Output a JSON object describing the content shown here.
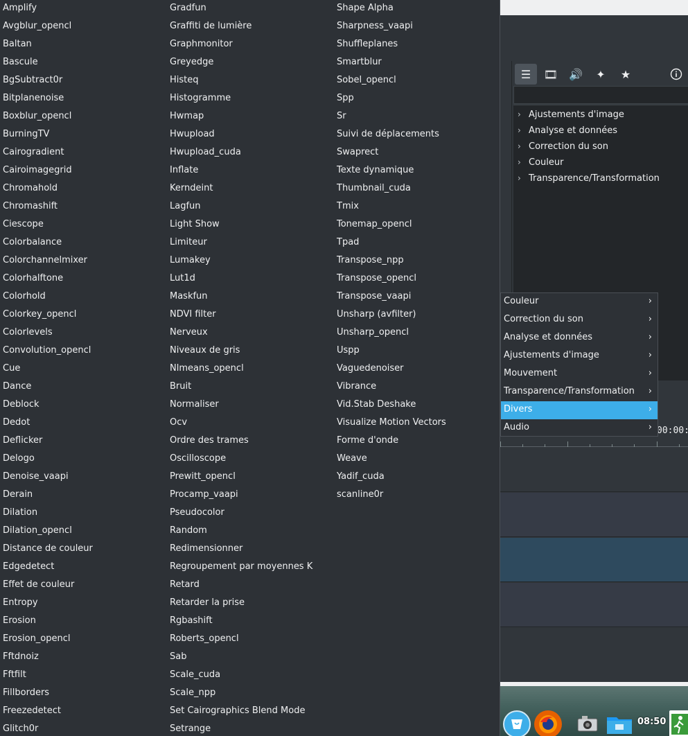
{
  "effects_menu": {
    "column_a": [
      "Amplify",
      "Avgblur_opencl",
      "Baltan",
      "Bascule",
      "BgSubtract0r",
      "Bitplanenoise",
      "Boxblur_opencl",
      "BurningTV",
      "Cairogradient",
      "Cairoimagegrid",
      "Chromahold",
      "Chromashift",
      "Ciescope",
      "Colorbalance",
      "Colorchannelmixer",
      "Colorhalftone",
      "Colorhold",
      "Colorkey_opencl",
      "Colorlevels",
      "Convolution_opencl",
      "Cue",
      "Dance",
      "Deblock",
      "Dedot",
      "Deflicker",
      "Delogo",
      "Denoise_vaapi",
      "Derain",
      "Dilation",
      "Dilation_opencl",
      "Distance de couleur",
      "Edgedetect",
      "Effet de couleur",
      "Entropy",
      "Erosion",
      "Erosion_opencl",
      "Fftdnoiz",
      "Fftfilt",
      "Fillborders",
      "Freezedetect",
      "Glitch0r"
    ],
    "column_b": [
      "Gradfun",
      "Graffiti de lumière",
      "Graphmonitor",
      "Greyedge",
      "Histeq",
      "Histogramme",
      "Hwmap",
      "Hwupload",
      "Hwupload_cuda",
      "Inflate",
      "Kerndeint",
      "Lagfun",
      "Light Show",
      "Limiteur",
      "Lumakey",
      "Lut1d",
      "Maskfun",
      "NDVI filter",
      "Nerveux",
      "Niveaux de gris",
      "Nlmeans_opencl",
      "Bruit",
      "Normaliser",
      "Ocv",
      "Ordre des trames",
      "Oscilloscope",
      "Prewitt_opencl",
      "Procamp_vaapi",
      "Pseudocolor",
      "Random",
      "Redimensionner",
      "Regroupement par moyennes K",
      "Retard",
      "Retarder la prise",
      "Rgbashift",
      "Roberts_opencl",
      "Sab",
      "Scale_cuda",
      "Scale_npp",
      "Set Cairographics Blend Mode",
      "Setrange"
    ],
    "column_c": [
      "Shape Alpha",
      "Sharpness_vaapi",
      "Shuffleplanes",
      "Smartblur",
      "Sobel_opencl",
      "Spp",
      "Sr",
      "Suivi de déplacements",
      "Swaprect",
      "Texte dynamique",
      "Thumbnail_cuda",
      "Tmix",
      "Tonemap_opencl",
      "Tpad",
      "Transpose_npp",
      "Transpose_opencl",
      "Transpose_vaapi",
      "Unsharp (avfilter)",
      "Unsharp_opencl",
      "Uspp",
      "Vaguedenoiser",
      "Vibrance",
      "Vid.Stab Deshake",
      "Visualize Motion Vectors",
      "Forme d'onde",
      "Weave",
      "Yadif_cuda",
      "scanline0r"
    ]
  },
  "category_menu": {
    "items": [
      {
        "label": "Couleur",
        "active": false
      },
      {
        "label": "Correction du son",
        "active": false
      },
      {
        "label": "Analyse et données",
        "active": false
      },
      {
        "label": "Ajustements d'image",
        "active": false
      },
      {
        "label": "Mouvement",
        "active": false
      },
      {
        "label": "Transparence/Transformation",
        "active": false
      },
      {
        "label": "Divers",
        "active": true
      },
      {
        "label": "Audio",
        "active": false
      }
    ],
    "arrow_glyph": "›"
  },
  "effects_panel": {
    "tabs": [
      {
        "icon": "list-icon",
        "glyph": "☰",
        "active": true
      },
      {
        "icon": "film-icon",
        "glyph": "🎞",
        "active": false
      },
      {
        "icon": "audio-icon",
        "glyph": "🔊",
        "active": false
      },
      {
        "icon": "custom-effects-icon",
        "glyph": "✦",
        "active": false
      },
      {
        "icon": "favorites-icon",
        "glyph": "★",
        "active": false
      }
    ],
    "info_glyph": "ⓘ",
    "tree": [
      "Ajustements d'image",
      "Analyse et données",
      "Correction du son",
      "Couleur",
      "Transparence/Transformation"
    ],
    "tree_chevron": "›"
  },
  "monitor": {
    "timecode": "00:00:"
  },
  "taskbar": {
    "clock": "08:50"
  },
  "colors": {
    "menu_bg": "#2d3136",
    "highlight": "#3daee9",
    "text": "#eff0f1",
    "tree_bg": "#232629"
  }
}
